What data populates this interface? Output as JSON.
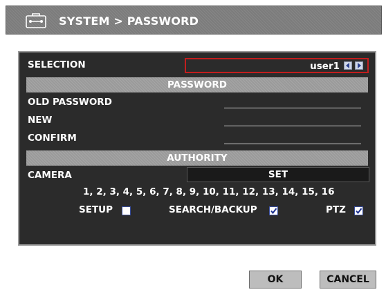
{
  "title": "SYSTEM > PASSWORD",
  "selection": {
    "label": "SELECTION",
    "value": "user1"
  },
  "password_section": {
    "header": "PASSWORD",
    "old_password_label": "OLD PASSWORD",
    "new_label": "NEW",
    "confirm_label": "CONFIRM"
  },
  "authority_section": {
    "header": "AUTHORITY",
    "camera_label": "CAMERA",
    "set_label": "SET",
    "camera_list": "1, 2, 3, 4, 5, 6, 7, 8, 9, 10, 11, 12, 13, 14, 15, 16",
    "setup_label": "SETUP",
    "search_backup_label": "SEARCH/BACKUP",
    "ptz_label": "PTZ",
    "setup_checked": false,
    "search_backup_checked": true,
    "ptz_checked": true
  },
  "buttons": {
    "ok": "OK",
    "cancel": "CANCEL"
  },
  "colors": {
    "panel_bg": "#2b2b2b",
    "selection_border": "#c21e1e",
    "section_bar": "#9a9a9a"
  },
  "icons": [
    "toolbox-icon",
    "arrow-left-icon",
    "arrow-right-icon",
    "checkbox-icon"
  ]
}
